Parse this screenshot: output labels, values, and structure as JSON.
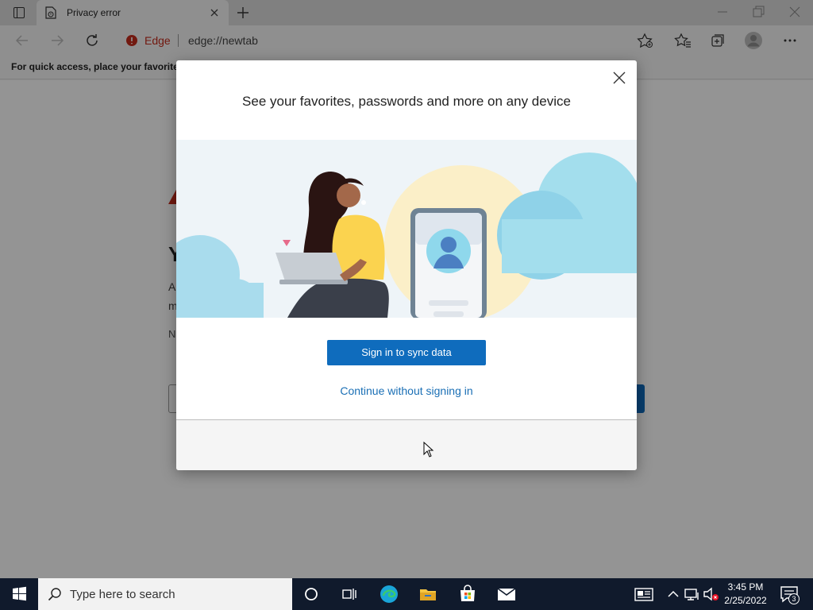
{
  "browser": {
    "tab": {
      "title": "Privacy error"
    },
    "address": {
      "brand": "Edge",
      "url": "edge://newtab"
    },
    "favorites_prompt": "For quick access, place your favorites h"
  },
  "page": {
    "headline": "Y",
    "line1": "A",
    "line2": "m",
    "line3": "N"
  },
  "dialog": {
    "heading": "See your favorites, passwords and more on any device",
    "primary_button": "Sign in to sync data",
    "secondary_link": "Continue without signing in"
  },
  "taskbar": {
    "search_placeholder": "Type here to search",
    "time": "3:45 PM",
    "date": "2/25/2022",
    "notification_count": "3"
  },
  "colors": {
    "accent": "#0f6cbd",
    "link": "#1a6fb5",
    "edge_brand": "#c42b1c",
    "taskbar": "#101a2c"
  }
}
